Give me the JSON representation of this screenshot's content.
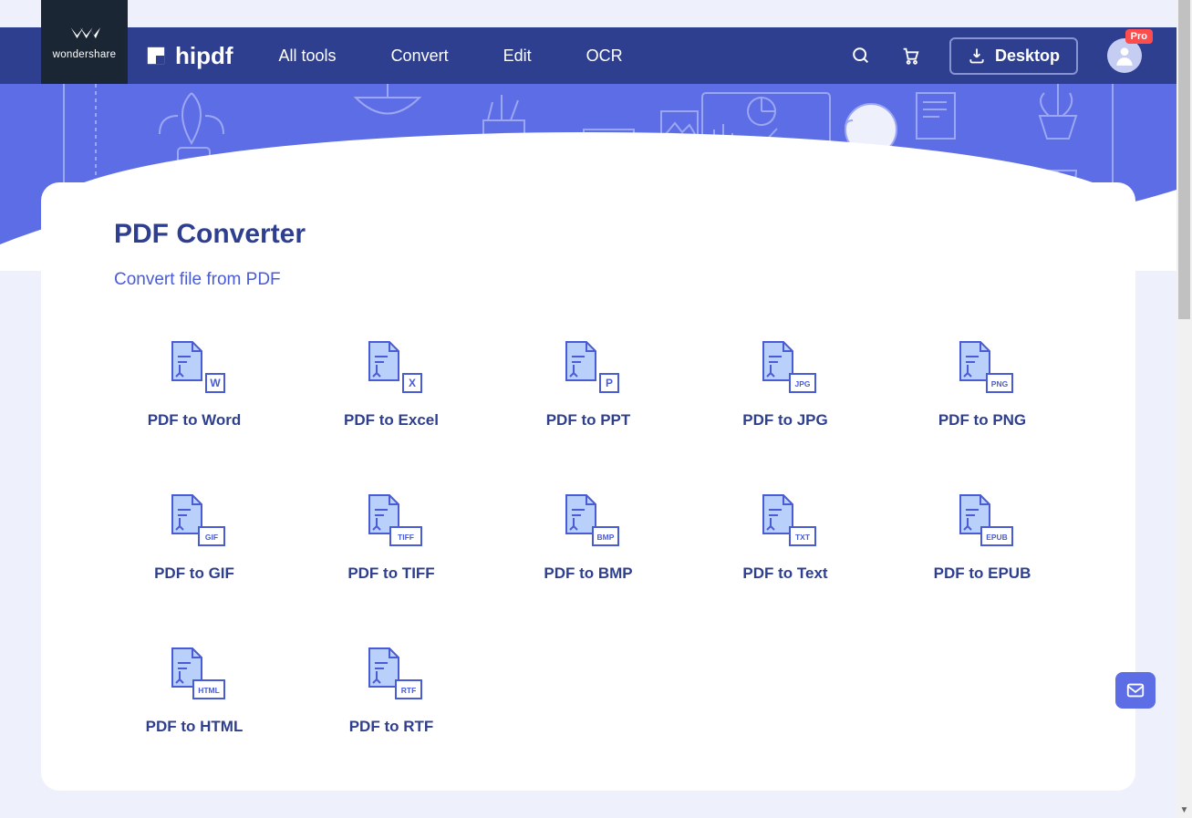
{
  "brand": {
    "name": "wondershare"
  },
  "logo": {
    "text": "hipdf"
  },
  "nav": {
    "all_tools": "All tools",
    "convert": "Convert",
    "edit": "Edit",
    "ocr": "OCR"
  },
  "header": {
    "desktop_label": "Desktop",
    "pro_badge": "Pro"
  },
  "page": {
    "title": "PDF Converter",
    "subtitle": "Convert file from PDF"
  },
  "tools": [
    {
      "label": "PDF to Word",
      "fmt": "W"
    },
    {
      "label": "PDF to Excel",
      "fmt": "X"
    },
    {
      "label": "PDF to PPT",
      "fmt": "P"
    },
    {
      "label": "PDF to JPG",
      "fmt": "JPG"
    },
    {
      "label": "PDF to PNG",
      "fmt": "PNG"
    },
    {
      "label": "PDF to GIF",
      "fmt": "GIF"
    },
    {
      "label": "PDF to TIFF",
      "fmt": "TIFF"
    },
    {
      "label": "PDF to BMP",
      "fmt": "BMP"
    },
    {
      "label": "PDF to Text",
      "fmt": "TXT"
    },
    {
      "label": "PDF to EPUB",
      "fmt": "EPUB"
    },
    {
      "label": "PDF to HTML",
      "fmt": "HTML"
    },
    {
      "label": "PDF to RTF",
      "fmt": "RTF"
    }
  ],
  "colors": {
    "header": "#2f3f8f",
    "accent": "#5c6de6",
    "brand_dark": "#1a2633",
    "pro": "#ff4d4d",
    "icon_fill": "#b9d0fb",
    "icon_stroke": "#4a5bd6"
  }
}
